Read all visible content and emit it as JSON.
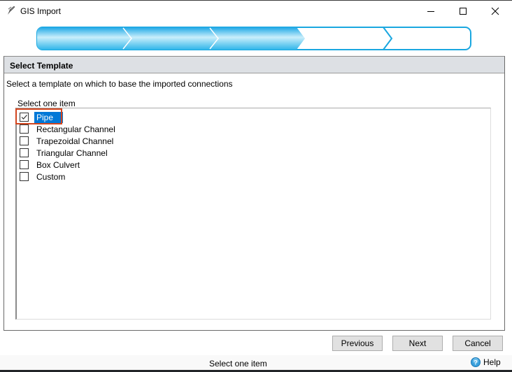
{
  "window": {
    "title": "GIS Import",
    "controls": {
      "minimize": "minimize-icon",
      "maximize": "maximize-icon",
      "close": "close-icon"
    }
  },
  "wizard": {
    "total_steps": 5,
    "completed_steps": 3,
    "active_color": "#29b6e8",
    "border_color": "#1aa7e0"
  },
  "panel": {
    "title": "Select Template",
    "instruction": "Select a template on which to base the imported connections",
    "list_label": "Select one item",
    "items": [
      {
        "label": "Pipe",
        "checked": true,
        "selected": true
      },
      {
        "label": "Rectangular Channel",
        "checked": false,
        "selected": false
      },
      {
        "label": "Trapezoidal Channel",
        "checked": false,
        "selected": false
      },
      {
        "label": "Triangular Channel",
        "checked": false,
        "selected": false
      },
      {
        "label": "Box Culvert",
        "checked": false,
        "selected": false
      },
      {
        "label": "Custom",
        "checked": false,
        "selected": false
      }
    ]
  },
  "buttons": {
    "previous": "Previous",
    "next": "Next",
    "cancel": "Cancel"
  },
  "status": {
    "text": "Select one item",
    "help_label": "Help"
  },
  "colors": {
    "selection": "#0078d7",
    "highlight_box": "#d2451e",
    "header_band": "#dde0e4"
  }
}
